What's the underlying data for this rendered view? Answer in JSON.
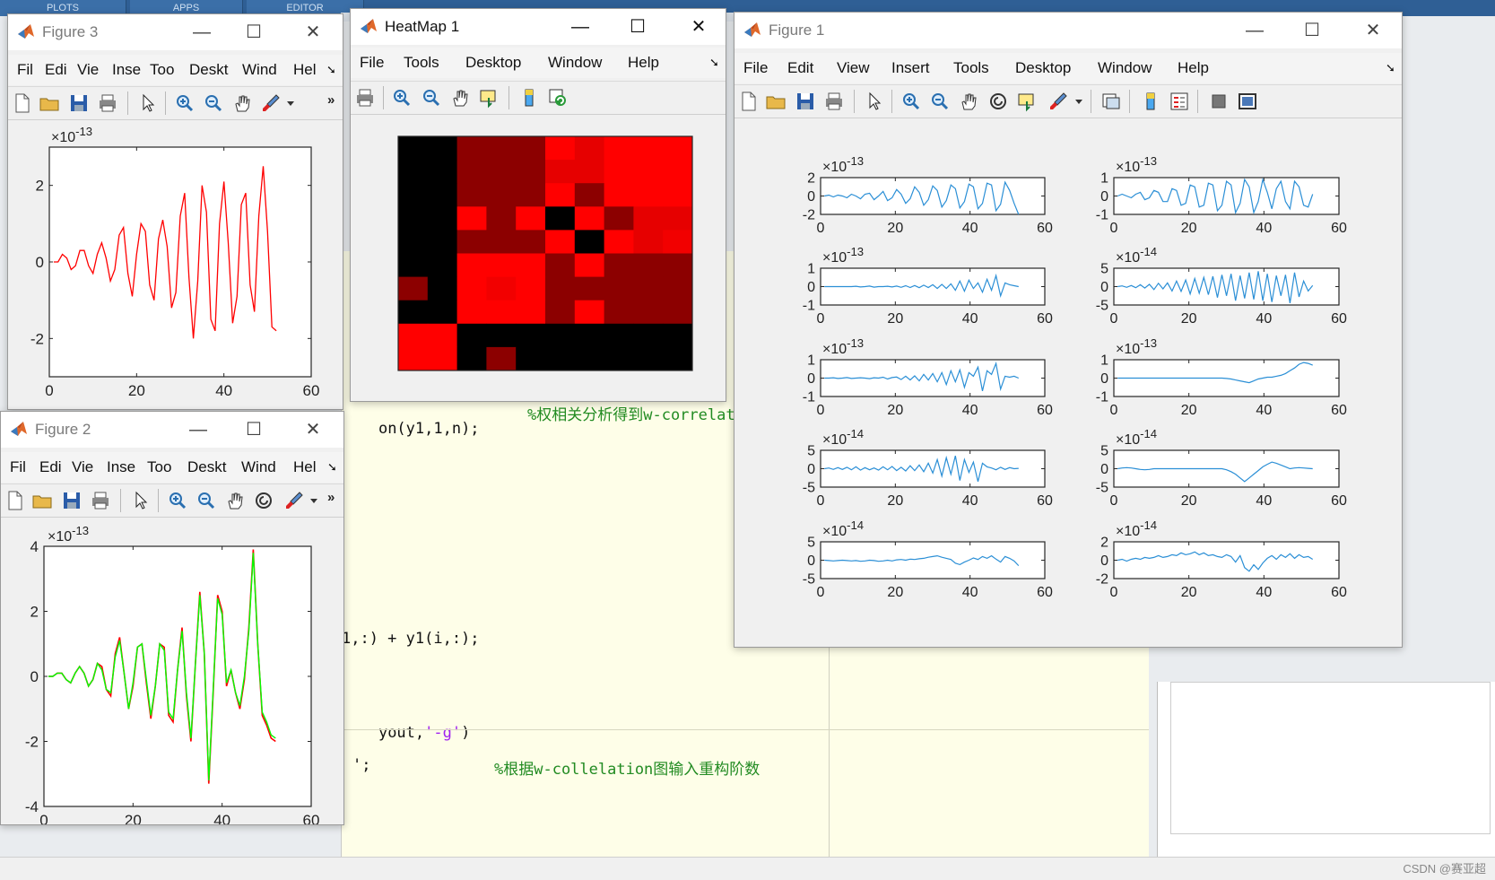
{
  "background": {
    "tabs": [
      "PLOTS",
      "APPS",
      "EDITOR"
    ],
    "editor_lines": [
      {
        "code": "on(y1,1,n);",
        "comment": "%权相关分析得到w-correlat"
      },
      {
        "code": "1,:) + y1(i,:);",
        "comment": ""
      },
      {
        "code": "yout,",
        "string": "'-g'",
        "tail": ")"
      },
      {
        "code": "';",
        "comment": "%根据w-collelation图输入重构阶数"
      }
    ],
    "watermark": "CSDN @赛亚超"
  },
  "figure3": {
    "title": "Figure 3",
    "menus": [
      "Fil",
      "Edi",
      "Vie",
      "Inse",
      "Too",
      "Deskt",
      "Wind",
      "Hel"
    ],
    "exponent": "×10",
    "exponent_power": "-13",
    "x_ticks": [
      "0",
      "20",
      "40",
      "60"
    ],
    "y_ticks": [
      "2",
      "0",
      "-2"
    ],
    "line_color": "#ff0000"
  },
  "heatmap": {
    "title": "HeatMap 1",
    "menus": [
      "File",
      "Tools",
      "Desktop",
      "Window",
      "Help"
    ]
  },
  "figure2": {
    "title": "Figure 2",
    "menus": [
      "Fil",
      "Edi",
      "Vie",
      "Inse",
      "Too",
      "Deskt",
      "Wind",
      "Hel"
    ],
    "exponent": "×10",
    "exponent_power": "-13",
    "x_ticks": [
      "0",
      "20",
      "40",
      "60"
    ],
    "y_ticks": [
      "4",
      "2",
      "0",
      "-2",
      "-4"
    ],
    "colors": {
      "original": "#ff0000",
      "reconstructed": "#00ff00"
    }
  },
  "figure1": {
    "title": "Figure 1",
    "menus": [
      "File",
      "Edit",
      "View",
      "Insert",
      "Tools",
      "Desktop",
      "Window",
      "Help"
    ],
    "line_color": "#2b8fd6",
    "x_ticks": [
      "0",
      "20",
      "40",
      "60"
    ],
    "subplots": [
      {
        "power": "-13",
        "y_ticks": [
          "2",
          "0",
          "-2"
        ]
      },
      {
        "power": "-13",
        "y_ticks": [
          "1",
          "0",
          "-1"
        ]
      },
      {
        "power": "-13",
        "y_ticks": [
          "1",
          "0",
          "-1"
        ]
      },
      {
        "power": "-14",
        "y_ticks": [
          "5",
          "0",
          "-5"
        ]
      },
      {
        "power": "-13",
        "y_ticks": [
          "1",
          "0",
          "-1"
        ]
      },
      {
        "power": "-13",
        "y_ticks": [
          "1",
          "0",
          "-1"
        ]
      },
      {
        "power": "-14",
        "y_ticks": [
          "5",
          "0",
          "-5"
        ]
      },
      {
        "power": "-14",
        "y_ticks": [
          "5",
          "0",
          "-5"
        ]
      },
      {
        "power": "-14",
        "y_ticks": [
          "5",
          "0",
          "-5"
        ]
      },
      {
        "power": "-14",
        "y_ticks": [
          "2",
          "0",
          "-2"
        ]
      }
    ]
  },
  "chart_data": [
    {
      "type": "line",
      "figure": "Figure 3",
      "ylabel_exponent": "×10^-13",
      "xlim": [
        0,
        60
      ],
      "ylim": [
        -3,
        3
      ],
      "series": [
        {
          "x": [
            1,
            2,
            3,
            4,
            5,
            6,
            7,
            8,
            9,
            10,
            11,
            12,
            13,
            14,
            15,
            16,
            17,
            18,
            19,
            20,
            21,
            22,
            23,
            24,
            25,
            26,
            27,
            28,
            29,
            30,
            31,
            32,
            33,
            34,
            35,
            36,
            37,
            38,
            39,
            40,
            41,
            42,
            43,
            44,
            45,
            46,
            47,
            48,
            49,
            50,
            51,
            52
          ],
          "y": [
            0,
            0,
            0.2,
            0.1,
            -0.2,
            -0.1,
            0.3,
            0.3,
            -0.1,
            -0.3,
            0.2,
            0.5,
            0.1,
            -0.5,
            -0.2,
            0.7,
            0.9,
            -0.3,
            -0.9,
            0.2,
            1.0,
            0.8,
            -0.6,
            -1.0,
            0.6,
            1.1,
            0.4,
            -1.2,
            -0.8,
            1.2,
            1.8,
            -0.4,
            -2.0,
            -0.5,
            2.0,
            1.3,
            -1.5,
            -1.8,
            1.0,
            2.1,
            0.5,
            -1.6,
            -0.9,
            1.5,
            1.8,
            -0.6,
            -1.3,
            1.2,
            2.5,
            0.8,
            -1.7,
            -1.8
          ]
        }
      ]
    },
    {
      "type": "heatmap",
      "figure": "HeatMap 1",
      "rows": 8,
      "cols": 10,
      "values": [
        [
          0,
          0,
          0.55,
          0.55,
          0.55,
          1,
          0.9,
          1,
          1,
          1
        ],
        [
          0,
          0,
          0.55,
          0.55,
          0.55,
          0.9,
          0.9,
          1,
          1,
          1
        ],
        [
          0,
          0,
          0.55,
          0.55,
          0.55,
          1,
          0.55,
          1,
          1,
          1
        ],
        [
          0,
          0,
          1,
          0.55,
          1,
          0,
          1,
          0.55,
          0.9,
          0.9
        ],
        [
          0,
          0,
          0.55,
          0.55,
          0.55,
          1,
          0,
          1,
          0.9,
          0.95
        ],
        [
          0,
          0,
          1,
          1,
          1,
          0.55,
          1,
          0.55,
          0.55,
          0.55
        ],
        [
          0.55,
          0,
          1,
          0.95,
          1,
          0.55,
          0.55,
          0.55,
          0.55,
          0.55
        ],
        [
          0,
          0,
          1,
          1,
          1,
          0.55,
          1,
          0.55,
          0.55,
          0.55
        ],
        [
          1,
          1,
          0,
          0,
          0,
          0,
          0,
          0,
          0,
          0
        ],
        [
          1,
          1,
          0,
          0.55,
          0,
          0,
          0,
          0,
          0,
          0
        ]
      ]
    },
    {
      "type": "line",
      "figure": "Figure 2",
      "ylabel_exponent": "×10^-13",
      "xlim": [
        0,
        60
      ],
      "ylim": [
        -4,
        4
      ],
      "series": [
        {
          "name": "",
          "color": "#ff0000",
          "x": [
            1,
            2,
            3,
            4,
            5,
            6,
            7,
            8,
            9,
            10,
            11,
            12,
            13,
            14,
            15,
            16,
            17,
            18,
            19,
            20,
            21,
            22,
            23,
            24,
            25,
            26,
            27,
            28,
            29,
            30,
            31,
            32,
            33,
            34,
            35,
            36,
            37,
            38,
            39,
            40,
            41,
            42,
            43,
            44,
            45,
            46,
            47,
            48,
            49,
            50,
            51,
            52
          ],
          "y": [
            0,
            0,
            0.1,
            0.1,
            -0.1,
            -0.2,
            0.1,
            0.3,
            0.1,
            -0.3,
            -0.1,
            0.4,
            0.3,
            -0.4,
            -0.6,
            0.7,
            1.2,
            0.1,
            -1.0,
            -0.3,
            0.9,
            1.0,
            -0.2,
            -1.3,
            -0.3,
            1.0,
            0.9,
            -1.2,
            -1.4,
            0.2,
            1.5,
            -0.6,
            -2.0,
            0.4,
            2.6,
            0.7,
            -3.3,
            -0.5,
            2.5,
            2.0,
            -0.3,
            0.2,
            -0.5,
            -1.0,
            -0.1,
            1.5,
            3.9,
            1.0,
            -1.2,
            -1.5,
            -1.9,
            -2.0
          ]
        },
        {
          "name": "",
          "color": "#00ff00",
          "x": [
            1,
            2,
            3,
            4,
            5,
            6,
            7,
            8,
            9,
            10,
            11,
            12,
            13,
            14,
            15,
            16,
            17,
            18,
            19,
            20,
            21,
            22,
            23,
            24,
            25,
            26,
            27,
            28,
            29,
            30,
            31,
            32,
            33,
            34,
            35,
            36,
            37,
            38,
            39,
            40,
            41,
            42,
            43,
            44,
            45,
            46,
            47,
            48,
            49,
            50,
            51,
            52
          ],
          "y": [
            0,
            0,
            0.1,
            0.1,
            -0.1,
            -0.2,
            0.1,
            0.3,
            0.1,
            -0.3,
            -0.1,
            0.4,
            0.2,
            -0.4,
            -0.5,
            0.6,
            1.1,
            0.1,
            -1.0,
            -0.2,
            0.9,
            1.0,
            -0.1,
            -1.2,
            -0.3,
            1.0,
            0.8,
            -1.1,
            -1.3,
            0.2,
            1.4,
            -0.5,
            -1.9,
            0.4,
            2.5,
            0.7,
            -3.2,
            -0.4,
            2.4,
            1.9,
            -0.2,
            0.2,
            -0.5,
            -0.9,
            0.0,
            1.4,
            3.8,
            1.0,
            -1.1,
            -1.4,
            -1.8,
            -1.9
          ]
        }
      ]
    },
    {
      "type": "line",
      "figure": "Figure 1",
      "subplots": 10,
      "xlim": [
        0,
        60
      ],
      "series": [
        {
          "subplot": 1,
          "scale": 1,
          "ylim": [
            -2,
            2
          ],
          "y": [
            0,
            0.1,
            -0.1,
            0.1,
            0,
            -0.2,
            0.2,
            0,
            -0.3,
            0.2,
            0.3,
            -0.4,
            0,
            0.5,
            -0.5,
            -0.2,
            0.7,
            0.2,
            -0.8,
            -0.3,
            1.0,
            0.4,
            -1.0,
            -0.4,
            1.1,
            0.6,
            -1.2,
            -0.5,
            1.2,
            0.8,
            -1.3,
            -0.6,
            1.3,
            1.0,
            -1.4,
            -0.8,
            1.4,
            1.2,
            -1.6,
            -0.9,
            1.5,
            0.6,
            -0.8,
            -2.0
          ]
        },
        {
          "subplot": 2,
          "scale": 1,
          "ylim": [
            -1,
            1
          ],
          "y": [
            0,
            0.1,
            0,
            -0.1,
            0.1,
            0.2,
            -0.2,
            -0.1,
            0.3,
            0.2,
            -0.3,
            -0.3,
            0.4,
            0.3,
            -0.5,
            -0.4,
            0.6,
            0.5,
            -0.6,
            -0.5,
            0.7,
            0.6,
            -0.8,
            -0.5,
            0.8,
            0.6,
            -0.9,
            -0.4,
            0.9,
            0.5,
            -0.9,
            -0.3,
            0.9,
            0.2,
            -0.7,
            0.4,
            0.8,
            -0.3,
            -0.7,
            0.8,
            0.5,
            -0.5,
            -0.6,
            0.1
          ]
        },
        {
          "subplot": 3,
          "scale": 1,
          "ylim": [
            -1,
            1
          ],
          "y": [
            0,
            0,
            0,
            0,
            0,
            0,
            0,
            0.02,
            -0.02,
            0,
            0.03,
            -0.03,
            0,
            0,
            0.02,
            -0.02,
            0.03,
            -0.04,
            0.05,
            -0.05,
            0.06,
            -0.06,
            0.08,
            -0.05,
            0.1,
            -0.1,
            0.12,
            -0.1,
            0.15,
            -0.2,
            0.3,
            -0.25,
            0.35,
            -0.1,
            0.2,
            -0.3,
            0.4,
            -0.2,
            0.6,
            -0.5,
            0.2,
            0.1,
            0.05,
            0
          ]
        },
        {
          "subplot": 4,
          "scale": 1,
          "ylim": [
            -5,
            5
          ],
          "y": [
            0,
            0.2,
            -0.2,
            0.3,
            -0.3,
            0.5,
            -0.4,
            0.6,
            -0.8,
            0.9,
            -0.6,
            1,
            -1.2,
            1.5,
            -1.3,
            1.8,
            -2,
            2.2,
            -1.8,
            2.5,
            -2.2,
            2.8,
            -3,
            3.2,
            -2.5,
            3.5,
            -3.8,
            3.0,
            -3.2,
            3.8,
            -3.5,
            4.2,
            -3.8,
            3.5,
            -4.2,
            3.0,
            -2.5,
            3.2,
            -4.5,
            3.8,
            -2.8,
            1.5,
            -1.2,
            0.3
          ]
        },
        {
          "subplot": 5,
          "scale": 1,
          "ylim": [
            -1,
            1
          ],
          "y": [
            0,
            0,
            0.02,
            -0.02,
            0,
            0.03,
            -0.02,
            0,
            0.02,
            0,
            -0.03,
            0.02,
            0,
            0.05,
            -0.05,
            0.03,
            0.06,
            -0.08,
            0.1,
            -0.1,
            0.12,
            -0.15,
            0.2,
            -0.1,
            0.25,
            -0.2,
            0.3,
            -0.35,
            0.4,
            -0.2,
            0.45,
            -0.5,
            0.3,
            0.1,
            0.6,
            -0.7,
            0.4,
            0.2,
            0.8,
            -0.6,
            0.1,
            0.05,
            0.1,
            0
          ]
        },
        {
          "subplot": 6,
          "scale": 1,
          "ylim": [
            -1,
            1
          ],
          "y": [
            0,
            0,
            0,
            0,
            0,
            0,
            0,
            0,
            0,
            0,
            0,
            0,
            0,
            0,
            0,
            0,
            0,
            0,
            0,
            0,
            0,
            0,
            0,
            0,
            -0.02,
            -0.05,
            -0.1,
            -0.15,
            -0.2,
            -0.25,
            -0.15,
            -0.05,
            0,
            0.05,
            0.05,
            0.1,
            0.15,
            0.25,
            0.4,
            0.55,
            0.75,
            0.85,
            0.8,
            0.7
          ]
        },
        {
          "subplot": 7,
          "scale": 1,
          "ylim": [
            -5,
            5
          ],
          "y": [
            0,
            0.2,
            -0.2,
            0.3,
            -0.2,
            0.4,
            -0.3,
            0.5,
            -0.4,
            0.3,
            -0.3,
            0.2,
            -0.4,
            0.5,
            -0.3,
            0.6,
            -0.5,
            0.4,
            -0.6,
            0.8,
            -0.5,
            1.0,
            -0.8,
            1.5,
            -1.2,
            2.5,
            -2.0,
            3.0,
            -1.5,
            3.5,
            -3.2,
            2.5,
            -1.0,
            1.8,
            -3.5,
            1.5,
            0.5,
            0.2,
            -0.3,
            0.4,
            -0.2,
            0.3,
            0,
            0.1
          ]
        },
        {
          "subplot": 8,
          "scale": 1,
          "ylim": [
            -5,
            5
          ],
          "y": [
            0,
            0.2,
            0.3,
            0.2,
            0,
            -0.2,
            -0.3,
            -0.2,
            0,
            0,
            0,
            0,
            0,
            0,
            0,
            0,
            0,
            0,
            0,
            0,
            0,
            0,
            0,
            0,
            -0.3,
            -0.8,
            -1.5,
            -2.5,
            -3.5,
            -2.5,
            -1.5,
            -0.5,
            0.5,
            1.2,
            1.8,
            1.5,
            1.0,
            0.5,
            0,
            0.2,
            0.3,
            0.2,
            0.1,
            0
          ]
        },
        {
          "subplot": 9,
          "scale": 1,
          "ylim": [
            -5,
            5
          ],
          "y": [
            0,
            -0.1,
            -0.2,
            -0.1,
            0,
            -0.1,
            -0.2,
            -0.1,
            -0.3,
            -0.2,
            0,
            -0.1,
            -0.3,
            -0.2,
            0,
            -0.2,
            0.1,
            0.2,
            0,
            0.3,
            0.2,
            0.4,
            0.5,
            0.8,
            1.0,
            1.2,
            0.8,
            0.5,
            0.2,
            -0.8,
            -1.2,
            -0.5,
            0,
            0.6,
            0.2,
            1.0,
            0.5,
            1.2,
            0.3,
            -0.5,
            1.0,
            0.5,
            -0.2,
            -1.5
          ]
        },
        {
          "subplot": 10,
          "scale": 1,
          "ylim": [
            -2,
            2
          ],
          "y": [
            0,
            0.1,
            -0.1,
            0.1,
            0.2,
            0.1,
            0.3,
            0.2,
            0.3,
            0.5,
            0.3,
            0.4,
            0.6,
            0.5,
            0.8,
            0.6,
            0.7,
            0.9,
            0.6,
            0.8,
            0.5,
            0.6,
            0.4,
            0.3,
            0.6,
            0.4,
            -0.2,
            0.5,
            -0.8,
            -1.2,
            -0.5,
            -1.0,
            -0.3,
            0.2,
            0.5,
            0.1,
            0.6,
            0.3,
            0.7,
            0.2,
            0.6,
            0.3,
            0.4,
            0.1
          ]
        }
      ]
    }
  ]
}
